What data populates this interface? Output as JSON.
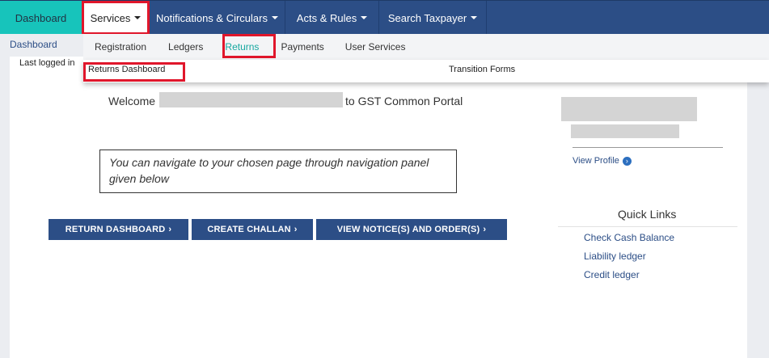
{
  "topnav": {
    "dashboard": "Dashboard",
    "services": "Services",
    "notifications": "Notifications & Circulars",
    "acts": "Acts & Rules",
    "search": "Search Taxpayer"
  },
  "submenu": {
    "items": [
      "Registration",
      "Ledgers",
      "Returns",
      "Payments",
      "User Services"
    ]
  },
  "dropdown": {
    "returns_dashboard": "Returns Dashboard",
    "transition_forms": "Transition Forms"
  },
  "breadcrumb": "Dashboard",
  "last_logged": "Last logged in",
  "welcome": {
    "prefix": "Welcome",
    "suffix": "to GST Common Portal"
  },
  "nav_hint": "You can navigate to your chosen page through navigation panel given below",
  "buttons": {
    "return_dashboard": "RETURN DASHBOARD",
    "create_challan": "CREATE CHALLAN",
    "view_notices": "VIEW NOTICE(S) AND ORDER(S)"
  },
  "profile": {
    "view_profile": "View Profile"
  },
  "quick_links": {
    "title": "Quick Links",
    "items": [
      "Check Cash Balance",
      "Liability ledger",
      "Credit ledger"
    ]
  },
  "colors": {
    "nav_bg": "#2c4e86",
    "active_tab": "#17c4bb",
    "highlight": "#e0162b"
  }
}
